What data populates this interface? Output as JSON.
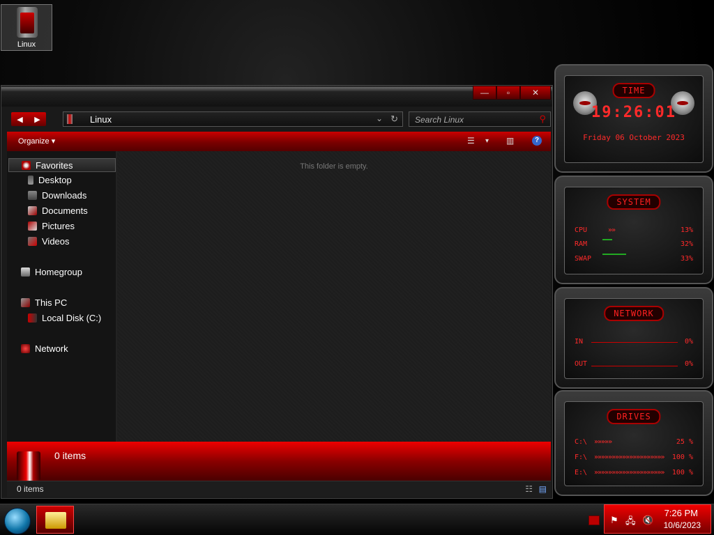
{
  "desktop_icon": {
    "label": "Linux"
  },
  "window": {
    "controls": {
      "minimize": "—",
      "maximize": "▫",
      "close": "✕"
    },
    "address": {
      "path": "Linux",
      "chevron": "⌄",
      "refresh": "↻"
    },
    "search": {
      "placeholder": "Search Linux",
      "icon": "⚲"
    },
    "toolbar": {
      "organize": "Organize ▾",
      "view_icon": "☰",
      "view_dropdown": "▾",
      "preview_icon": "▥",
      "help_icon": "?"
    },
    "nav": {
      "favorites": "Favorites",
      "desktop": "Desktop",
      "downloads": "Downloads",
      "documents": "Documents",
      "pictures": "Pictures",
      "videos": "Videos",
      "homegroup": "Homegroup",
      "thispc": "This PC",
      "localdisk": "Local Disk (C:)",
      "network": "Network"
    },
    "empty_message": "This folder is empty.",
    "details_text": "0 items",
    "status_text": "0 items",
    "status_view1": "☷",
    "status_view2": "▤"
  },
  "gadgets": {
    "time": {
      "title": "TIME",
      "clock": "19:26:01",
      "date": "Friday 06 October 2023"
    },
    "system": {
      "title": "SYSTEM",
      "rows": [
        {
          "name": "CPU",
          "bar": "»»",
          "value": "13%"
        },
        {
          "name": "RAM",
          "bar": "",
          "value": "32%"
        },
        {
          "name": "SWAP",
          "bar": "",
          "value": "33%"
        }
      ]
    },
    "network": {
      "title": "NETWORK",
      "rows": [
        {
          "name": "IN",
          "value": "0%"
        },
        {
          "name": "OUT",
          "value": "0%"
        }
      ]
    },
    "drives": {
      "title": "DRIVES",
      "rows": [
        {
          "name": "C:\\",
          "bar": "»»»»»",
          "value": "25 %"
        },
        {
          "name": "F:\\",
          "bar": "»»»»»»»»»»»»»»»»»»»»",
          "value": "100 %"
        },
        {
          "name": "E:\\",
          "bar": "»»»»»»»»»»»»»»»»»»»»",
          "value": "100 %"
        }
      ]
    }
  },
  "taskbar": {
    "time": "7:26 PM",
    "date": "10/6/2023",
    "tray_icons": {
      "flag": "⚑",
      "network": "🖧",
      "volume": "🔇"
    }
  },
  "colors": {
    "accent": "#cc0000",
    "text": "#ffffff"
  }
}
